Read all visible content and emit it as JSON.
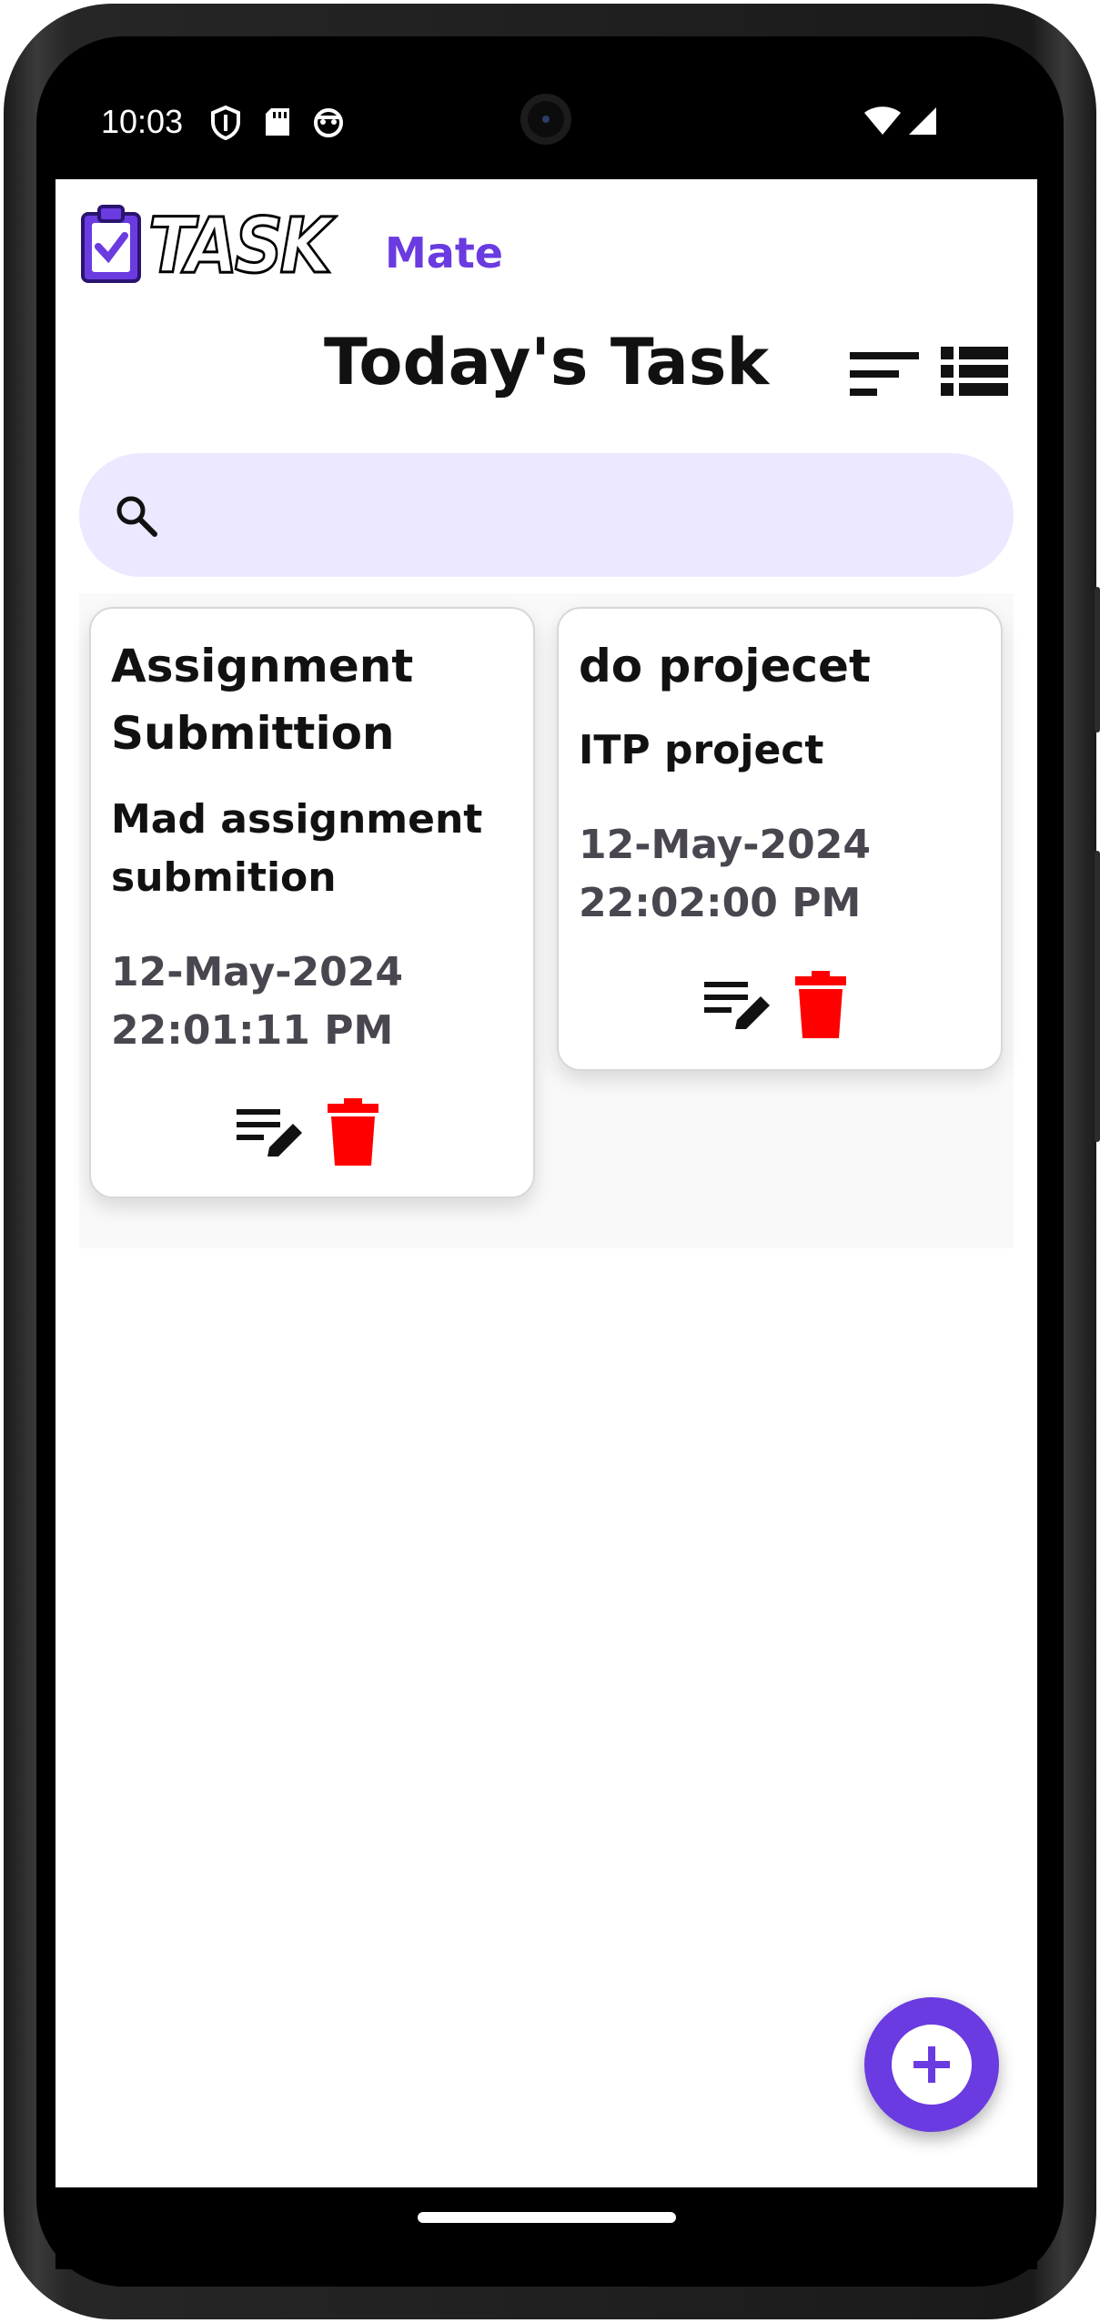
{
  "status_bar": {
    "time": "10:03",
    "icons": [
      "shield-icon",
      "sd-card-icon",
      "android-icon",
      "wifi-icon",
      "signal-icon"
    ]
  },
  "app": {
    "logo_text": "TASK",
    "logo_suffix": "Mate",
    "brand_color": "#6a3be0",
    "title": "Today's Task",
    "search_placeholder": ""
  },
  "header_actions": [
    "sort-icon",
    "list-view-icon"
  ],
  "tasks": [
    {
      "title": "Assignment Submittion",
      "description": "Mad assignment submition",
      "date": "12-May-2024",
      "time": "22:01:11 PM"
    },
    {
      "title": "do projecet",
      "description": "ITP project",
      "date": "12-May-2024",
      "time": "22:02:00 PM"
    }
  ],
  "colors": {
    "delete": "#ff0000",
    "search_bg": "#ece8ff",
    "accent": "#6a3be0"
  },
  "fab": {
    "icon": "plus-icon"
  }
}
